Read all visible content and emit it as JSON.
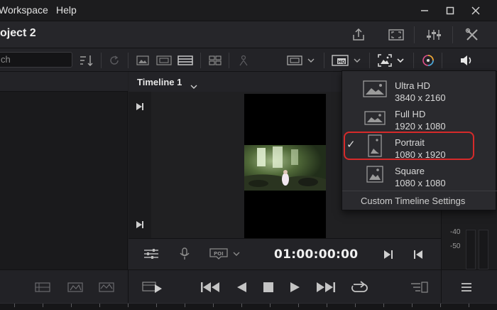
{
  "menubar": {
    "items": [
      "Workspace",
      "Help"
    ]
  },
  "project": {
    "title": "oject 2"
  },
  "toolbar": {
    "search_placeholder": "ch"
  },
  "viewer": {
    "timeline_name": "Timeline 1",
    "timecode": "01:00:00:00"
  },
  "audio_meter": {
    "labels": [
      "-40",
      "-50"
    ]
  },
  "timeline_resolution_menu": {
    "options": [
      {
        "name": "Ultra HD",
        "size": "3840 x 2160",
        "selected": false,
        "icon": "landscape-image-icon"
      },
      {
        "name": "Full HD",
        "size": "1920 x 1080",
        "selected": false,
        "icon": "landscape-image-icon"
      },
      {
        "name": "Portrait",
        "size": "1080 x 1920",
        "selected": true,
        "icon": "portrait-image-icon"
      },
      {
        "name": "Square",
        "size": "1080 x 1080",
        "selected": false,
        "icon": "square-image-icon"
      }
    ],
    "check_mark": "✓",
    "custom_label": "Custom Timeline Settings",
    "highlight_color": "#d62a2a"
  }
}
